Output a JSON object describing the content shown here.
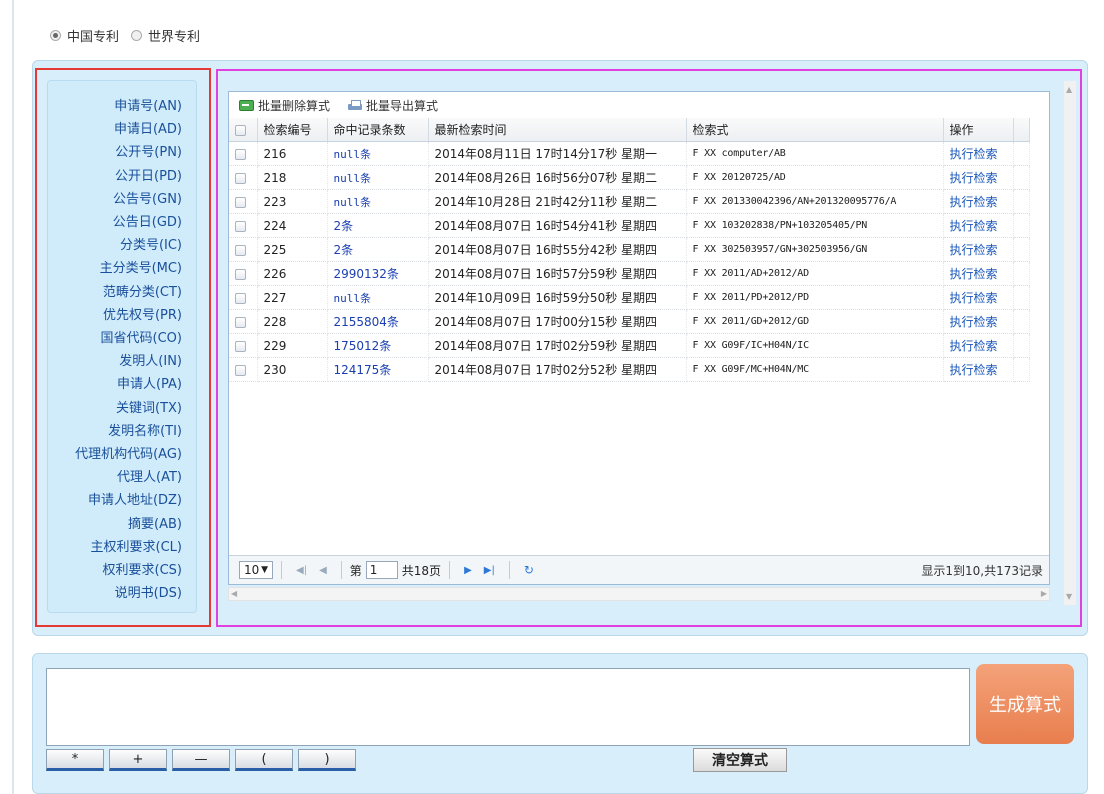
{
  "patent_type": {
    "options": [
      "中国专利",
      "世界专利"
    ],
    "selected": "中国专利"
  },
  "fields": [
    "申请号(AN)",
    "申请日(AD)",
    "公开号(PN)",
    "公开日(PD)",
    "公告号(GN)",
    "公告日(GD)",
    "分类号(IC)",
    "主分类号(MC)",
    "范畴分类(CT)",
    "优先权号(PR)",
    "国省代码(CO)",
    "发明人(IN)",
    "申请人(PA)",
    "关键词(TX)",
    "发明名称(TI)",
    "代理机构代码(AG)",
    "代理人(AT)",
    "申请人地址(DZ)",
    "摘要(AB)",
    "主权利要求(CL)",
    "权利要求(CS)",
    "说明书(DS)"
  ],
  "toolbar": {
    "batch_delete": "批量删除算式",
    "batch_export": "批量导出算式"
  },
  "table": {
    "columns": [
      "检索编号",
      "命中记录条数",
      "最新检索时间",
      "检索式",
      "操作"
    ],
    "rows": [
      {
        "id": "216",
        "hits": "null条",
        "time": "2014年08月11日 17时14分17秒 星期一",
        "expr": "F XX computer/AB",
        "action": "执行检索"
      },
      {
        "id": "218",
        "hits": "null条",
        "time": "2014年08月26日 16时56分07秒 星期二",
        "expr": "F XX 20120725/AD",
        "action": "执行检索"
      },
      {
        "id": "223",
        "hits": "null条",
        "time": "2014年10月28日 21时42分11秒 星期二",
        "expr": "F XX 201330042396/AN+201320095776/A",
        "action": "执行检索"
      },
      {
        "id": "224",
        "hits": "2条",
        "time": "2014年08月07日 16时54分41秒 星期四",
        "expr": "F XX 103202838/PN+103205405/PN",
        "action": "执行检索"
      },
      {
        "id": "225",
        "hits": "2条",
        "time": "2014年08月07日 16时55分42秒 星期四",
        "expr": "F XX 302503957/GN+302503956/GN",
        "action": "执行检索"
      },
      {
        "id": "226",
        "hits": "2990132条",
        "time": "2014年08月07日 16时57分59秒 星期四",
        "expr": "F XX 2011/AD+2012/AD",
        "action": "执行检索"
      },
      {
        "id": "227",
        "hits": "null条",
        "time": "2014年10月09日 16时59分50秒 星期四",
        "expr": "F XX 2011/PD+2012/PD",
        "action": "执行检索"
      },
      {
        "id": "228",
        "hits": "2155804条",
        "time": "2014年08月07日 17时00分15秒 星期四",
        "expr": "F XX 2011/GD+2012/GD",
        "action": "执行检索"
      },
      {
        "id": "229",
        "hits": "175012条",
        "time": "2014年08月07日 17时02分59秒 星期四",
        "expr": "F XX G09F/IC+H04N/IC",
        "action": "执行检索"
      },
      {
        "id": "230",
        "hits": "124175条",
        "time": "2014年08月07日 17时02分52秒 星期四",
        "expr": "F XX G09F/MC+H04N/MC",
        "action": "执行检索"
      }
    ]
  },
  "pager": {
    "page_size": "10",
    "page_prefix": "第",
    "page": "1",
    "total_pages": "共18页",
    "info": "显示1到10,共173记录"
  },
  "bottom": {
    "generate": "生成算式",
    "operators": [
      "*",
      "+",
      "—",
      "(",
      ")"
    ],
    "clear": "清空算式"
  }
}
